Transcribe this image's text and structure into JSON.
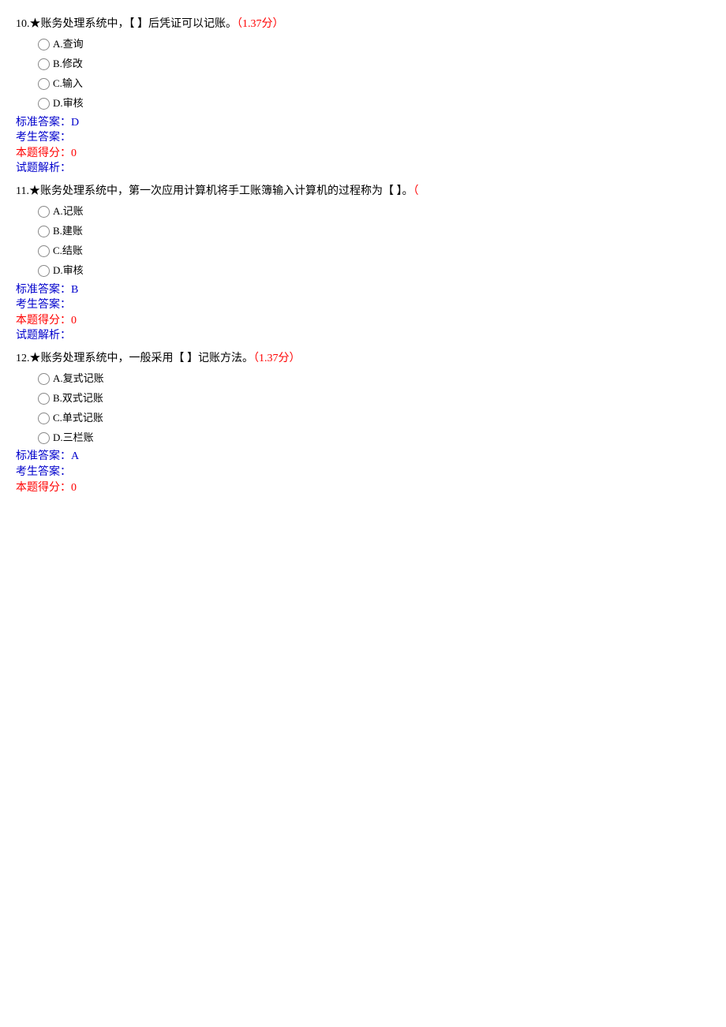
{
  "questions": [
    {
      "number": "10.",
      "prefix": "★",
      "text": "账务处理系统中，【 】后凭证可以记账。",
      "score_prefix": "（",
      "score": "1.37分",
      "score_suffix": "）",
      "options": [
        {
          "letter": "A.",
          "text": "查询"
        },
        {
          "letter": "B.",
          "text": "修改"
        },
        {
          "letter": "C.",
          "text": "输入"
        },
        {
          "letter": "D.",
          "text": "审核"
        }
      ],
      "standard_answer_label": "标准答案：",
      "standard_answer": "D",
      "student_answer_label": "考生答案：",
      "student_answer": "",
      "score_label": "本题得分：",
      "score_value": "0",
      "analysis_label": "试题解析：",
      "analysis": ""
    },
    {
      "number": "11.",
      "prefix": "★",
      "text": "账务处理系统中，第一次应用计算机将手工账簿输入计算机的过程称为【 】。",
      "score_prefix": "（",
      "score": "",
      "score_suffix": "",
      "options": [
        {
          "letter": "A.",
          "text": "记账"
        },
        {
          "letter": "B.",
          "text": "建账"
        },
        {
          "letter": "C.",
          "text": "结账"
        },
        {
          "letter": "D.",
          "text": "审核"
        }
      ],
      "standard_answer_label": "标准答案：",
      "standard_answer": "B",
      "student_answer_label": "考生答案：",
      "student_answer": "",
      "score_label": "本题得分：",
      "score_value": "0",
      "analysis_label": "试题解析：",
      "analysis": ""
    },
    {
      "number": "12.",
      "prefix": "★",
      "text": "账务处理系统中，一般采用【 】记账方法。",
      "score_prefix": "（",
      "score": "1.37分",
      "score_suffix": "）",
      "options": [
        {
          "letter": "A.",
          "text": "复式记账"
        },
        {
          "letter": "B.",
          "text": "双式记账"
        },
        {
          "letter": "C.",
          "text": "单式记账"
        },
        {
          "letter": "D.",
          "text": "三栏账"
        }
      ],
      "standard_answer_label": "标准答案：",
      "standard_answer": "A",
      "student_answer_label": "考生答案：",
      "student_answer": "",
      "score_label": "本题得分：",
      "score_value": "0",
      "analysis_label": "",
      "analysis": ""
    }
  ]
}
